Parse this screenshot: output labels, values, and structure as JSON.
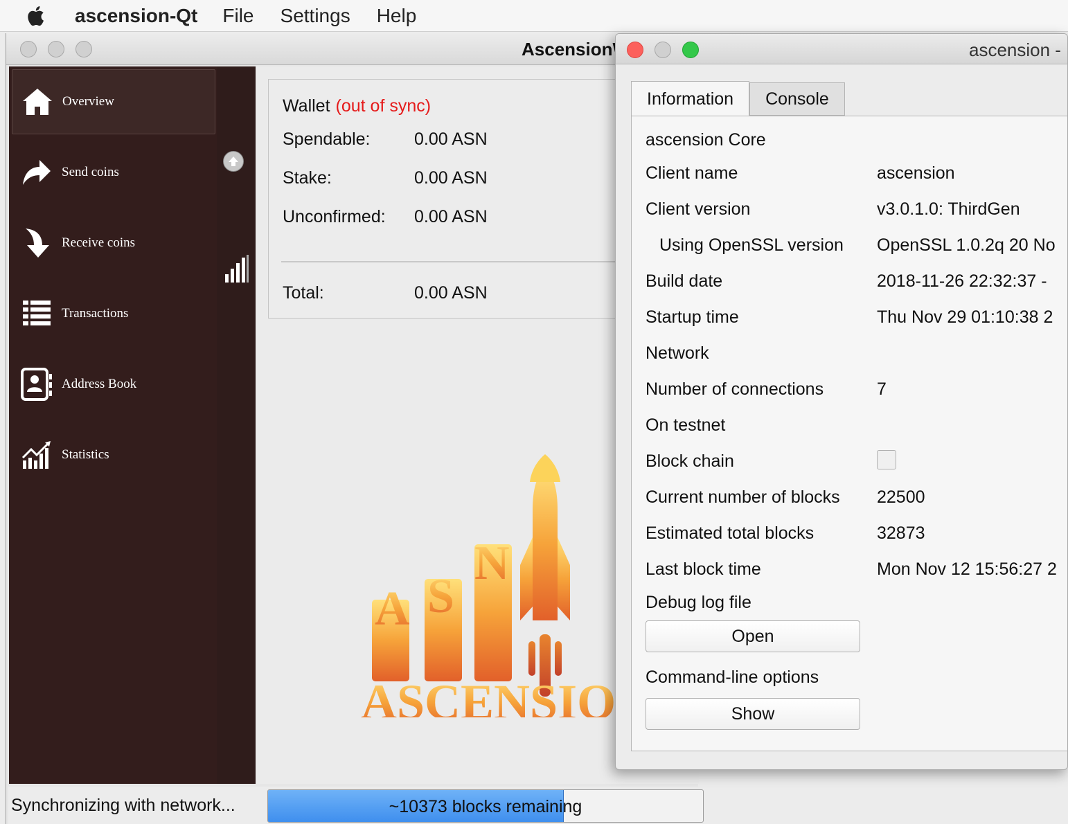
{
  "menubar": {
    "app_name": "ascension-Qt",
    "items": [
      "File",
      "Settings",
      "Help"
    ]
  },
  "main_window": {
    "title": "AscensionW",
    "sidebar": [
      {
        "label": "Overview",
        "icon": "home-icon",
        "active": true
      },
      {
        "label": "Send coins",
        "icon": "send-arrow-icon"
      },
      {
        "label": "Receive coins",
        "icon": "receive-arrow-icon"
      },
      {
        "label": "Transactions",
        "icon": "list-icon"
      },
      {
        "label": "Address Book",
        "icon": "contact-book-icon"
      },
      {
        "label": "Statistics",
        "icon": "chart-icon"
      }
    ],
    "wallet": {
      "heading": "Wallet",
      "sync_status": "(out of sync)",
      "spendable_label": "Spendable:",
      "spendable_value": "0.00 ASN",
      "stake_label": "Stake:",
      "stake_value": "0.00 ASN",
      "unconfirmed_label": "Unconfirmed:",
      "unconfirmed_value": "0.00 ASN",
      "total_label": "Total:",
      "total_value": "0.00 ASN"
    },
    "logo": {
      "letters": [
        "A",
        "S",
        "N"
      ],
      "wordmark": "ASCENSION"
    }
  },
  "statusbar": {
    "sync_text": "Synchronizing with network...",
    "progress_text": "~10373 blocks remaining",
    "progress_fraction": 0.68
  },
  "debug_window": {
    "title": "ascension -",
    "tabs": [
      "Information",
      "Console"
    ],
    "heading": "ascension Core",
    "client_name_label": "Client name",
    "client_name": "ascension",
    "client_version_label": "Client version",
    "client_version": "v3.0.1.0: ThirdGen",
    "openssl_label": "Using OpenSSL version",
    "openssl": "OpenSSL 1.0.2q  20 No",
    "build_date_label": "Build date",
    "build_date": "2018-11-26 22:32:37 -",
    "startup_label": "Startup time",
    "startup": "Thu Nov 29 01:10:38 2",
    "network_label": "Network",
    "connections_label": "Number of connections",
    "connections": "7",
    "testnet_label": "On testnet",
    "blockchain_label": "Block chain",
    "current_blocks_label": "Current number of blocks",
    "current_blocks": "22500",
    "estimated_blocks_label": "Estimated total blocks",
    "estimated_blocks": "32873",
    "last_block_label": "Last block time",
    "last_block": "Mon Nov 12 15:56:27 2",
    "debug_log_label": "Debug log file",
    "open_button": "Open",
    "cmdline_label": "Command-line options",
    "show_button": "Show"
  }
}
